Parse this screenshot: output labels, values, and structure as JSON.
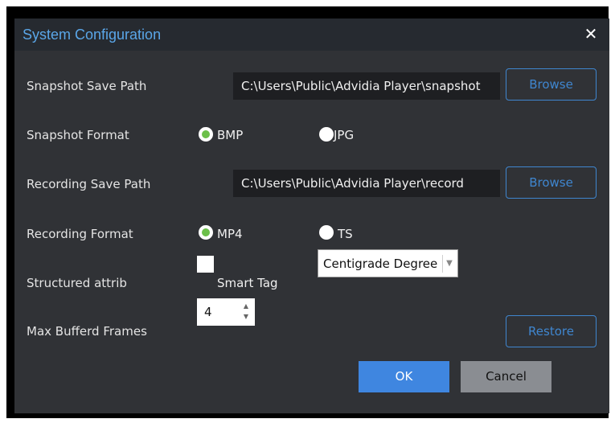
{
  "dialog": {
    "title": "System Configuration",
    "close_glyph": "✕"
  },
  "snapshot_path": {
    "label": "Snapshot Save Path",
    "value": "C:\\Users\\Public\\Advidia Player\\snapshot",
    "browse_label": "Browse"
  },
  "snapshot_format": {
    "label": "Snapshot Format",
    "options": [
      {
        "label": "BMP",
        "checked": true
      },
      {
        "label": "JPG",
        "checked": false
      }
    ]
  },
  "recording_path": {
    "label": "Recording Save Path",
    "value": "C:\\Users\\Public\\Advidia Player\\record",
    "browse_label": "Browse"
  },
  "recording_format": {
    "label": "Recording Format",
    "options": [
      {
        "label": "MP4",
        "checked": true
      },
      {
        "label": "TS",
        "checked": false
      }
    ]
  },
  "structured": {
    "label": "Structured attrib",
    "checkbox_label": "Smart Tag",
    "checked": false,
    "select_value": "Centigrade Degree",
    "arrow_glyph": "▼"
  },
  "buffer": {
    "label": "Max Bufferd Frames",
    "value": "4",
    "up_glyph": "▲",
    "down_glyph": "▼",
    "restore_label": "Restore"
  },
  "actions": {
    "ok_label": "OK",
    "cancel_label": "Cancel"
  },
  "colors": {
    "accent": "#3f86cf",
    "radio_checked": "#6cc04a",
    "dialog_bg": "#303236",
    "title_color": "#5aa6e8"
  },
  "icons": {
    "close": "close-icon",
    "select_arrow": "chevron-down-icon",
    "spin_up": "spin-up-icon",
    "spin_down": "spin-down-icon"
  }
}
